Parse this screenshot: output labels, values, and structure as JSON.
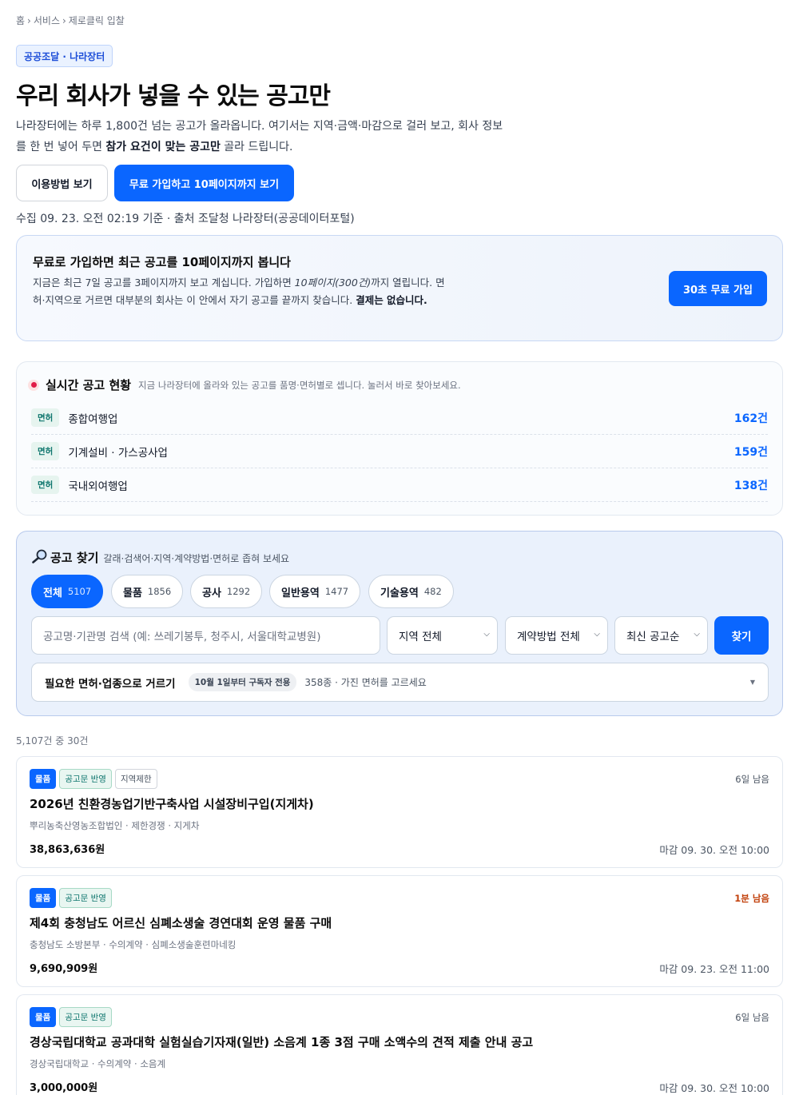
{
  "breadcrumb": [
    "홈",
    "서비스",
    "제로클릭 입찰"
  ],
  "tag": "공공조달 · 나라장터",
  "hero": {
    "title": "우리 회사가 넣을 수 있는 공고만",
    "desc_1": "나라장터에는 하루 1,800건 넘는 공고가 올라옵니다. 여기서는 지역·금액·마감으로 걸러 보고, 회사 정보를 한 번 넣어 두면 ",
    "desc_bold": "참가 요건이 맞는 공고만",
    "desc_2": " 골라 드립니다.",
    "btn_howto": "이용방법 보기",
    "btn_signup": "무료 가입하고 10페이지까지 보기"
  },
  "collected": "수집 09. 23. 오전 02:19 기준 · 출처 조달청 나라장터(공공데이터포털)",
  "promo": {
    "title": "무료로 가입하면 최근 공고를 10페이지까지 봅니다",
    "text_1": "지금은 최근 7일 공고를 3페이지까지 보고 계십니다. 가입하면 ",
    "text_italic": "10페이지(300건)",
    "text_2": "까지 열립니다. 면허·지역으로 거르면 대부분의 회사는 이 안에서 자기 공고를 끝까지 찾습니다. ",
    "text_bold": "결제는 없습니다.",
    "button": "30초 무료 가입"
  },
  "live": {
    "title": "실시간 공고 현황",
    "subtitle": "지금 나라장터에 올라와 있는 공고를 품명·면허별로 셉니다. 눌러서 바로 찾아보세요.",
    "rows": [
      {
        "badge": "면허",
        "name": "종합여행업",
        "count": "162건"
      },
      {
        "badge": "면허",
        "name": "기계설비 · 가스공사업",
        "count": "159건"
      },
      {
        "badge": "면허",
        "name": "국내외여행업",
        "count": "138건"
      }
    ]
  },
  "search": {
    "title": "공고 찾기",
    "subtitle": "갈래·검색어·지역·계약방법·면허로 좁혀 보세요",
    "chips": [
      {
        "label": "전체",
        "count": "5107"
      },
      {
        "label": "물품",
        "count": "1856"
      },
      {
        "label": "공사",
        "count": "1292"
      },
      {
        "label": "일반용역",
        "count": "1477"
      },
      {
        "label": "기술용역",
        "count": "482"
      }
    ],
    "placeholder": "공고명·기관명 검색 (예: 쓰레기봉투, 청주시, 서울대학교병원)",
    "region": "지역 전체",
    "method": "계약방법 전체",
    "sort": "최신 공고순",
    "find": "찾기",
    "filter_title": "필요한 면허·업종으로 거르기",
    "filter_badge": "10월 1일부터 구독자 전용",
    "filter_hint": "358종 · 가진 면허를 고르세요"
  },
  "count_line": "5,107건 중 30건",
  "cards": [
    {
      "category": "물품",
      "notice": "공고문 반영",
      "region": "지역제한",
      "remaining": "6일 남음",
      "urgent": false,
      "title": "2026년 친환경농업기반구축사업 시설장비구입(지게차)",
      "meta": [
        "뿌리농축산영농조합법인",
        "제한경쟁",
        "지게차"
      ],
      "price": "38,863,636원",
      "deadline": "마감 09. 30. 오전 10:00"
    },
    {
      "category": "물품",
      "notice": "공고문 반영",
      "region": "",
      "remaining": "1분 남음",
      "urgent": true,
      "title": "제4회 충청남도 어르신 심폐소생술 경연대회 운영 물품 구매",
      "meta": [
        "충청남도 소방본부",
        "수의계약",
        "심폐소생술훈련마네킹"
      ],
      "price": "9,690,909원",
      "deadline": "마감 09. 23. 오전 11:00"
    },
    {
      "category": "물품",
      "notice": "공고문 반영",
      "region": "",
      "remaining": "6일 남음",
      "urgent": false,
      "title": "경상국립대학교 공과대학 실험실습기자재(일반) 소음계 1종 3점 구매 소액수의 견적 제출 안내 공고",
      "meta": [
        "경상국립대학교",
        "수의계약",
        "소음계"
      ],
      "price": "3,000,000원",
      "deadline": "마감 09. 30. 오전 10:00"
    }
  ]
}
